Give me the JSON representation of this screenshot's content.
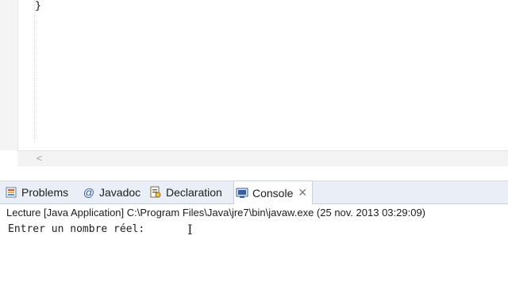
{
  "editor": {
    "code_line": "}",
    "scroll_left_icon": "<"
  },
  "views": {
    "tabs": [
      {
        "label": "Problems",
        "icon": "problems-icon"
      },
      {
        "label": "Javadoc",
        "icon": "at-icon"
      },
      {
        "label": "Declaration",
        "icon": "declaration-icon"
      },
      {
        "label": "Console",
        "icon": "console-icon",
        "active": true,
        "close": "✕"
      }
    ]
  },
  "console": {
    "header": "Lecture [Java Application] C:\\Program Files\\Java\\jre7\\bin\\javaw.exe (25 nov. 2013 03:29:09)",
    "output": "Entrer un nombre réel:"
  },
  "colors": {
    "tabbar_bg": "#e9eef7",
    "active_tab_bg": "#ffffff",
    "editor_ruler": "#f4f4f4"
  }
}
